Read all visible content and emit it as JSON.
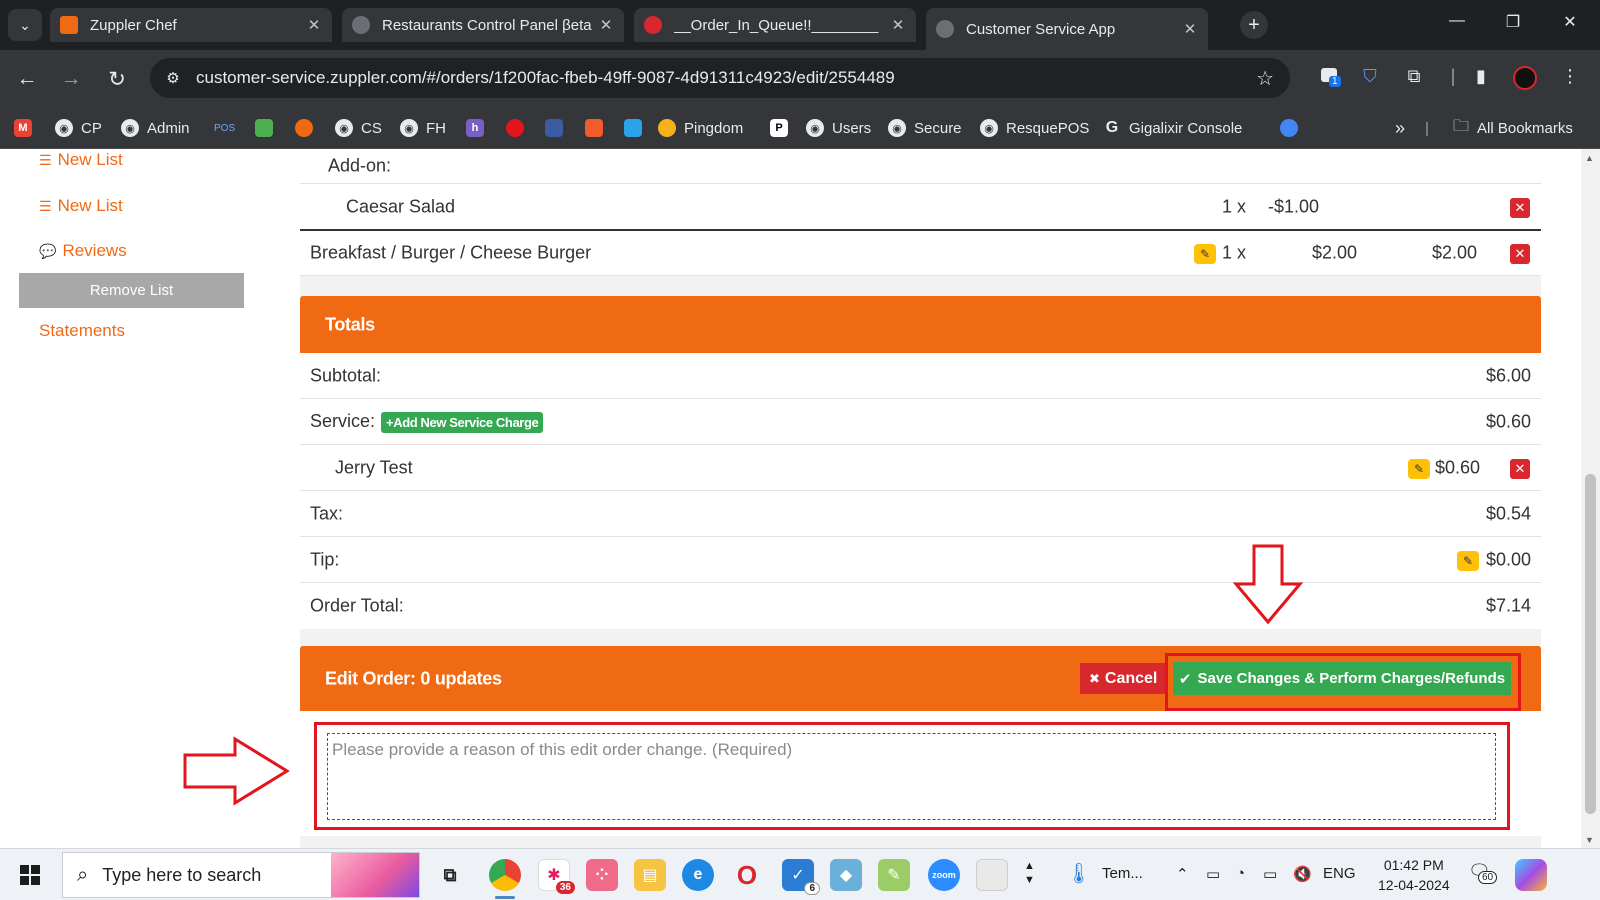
{
  "browser": {
    "tabs": [
      {
        "title": "Zuppler Chef",
        "active": false
      },
      {
        "title": "Restaurants Control Panel βeta",
        "active": false
      },
      {
        "title": "__Order_In_Queue!!________",
        "active": false
      },
      {
        "title": "Customer Service App",
        "active": true
      }
    ],
    "tab_close": "✕",
    "new_tab": "+",
    "url": "customer-service.zuppler.com/#/orders/1f200fac-fbeb-49ff-9087-4d91311c4923/edit/2554489",
    "extension_badge": "1",
    "bookmarks": [
      {
        "label": "CP"
      },
      {
        "label": "Admin"
      },
      {
        "label": "POS"
      },
      {
        "label": "Pingdom"
      },
      {
        "label": "Users"
      },
      {
        "label": "Secure"
      },
      {
        "label": "ResquePOS"
      },
      {
        "label": "Gigalixir Console"
      },
      {
        "label": "All Bookmarks"
      }
    ],
    "bookmark_overflow": "»"
  },
  "sidebar": {
    "links": [
      "New List",
      "New List",
      "Reviews"
    ],
    "remove_button": "Remove List",
    "statements": "Statements"
  },
  "order": {
    "addon_label": "Add-on:",
    "addon_item": {
      "name": "Caesar Salad",
      "qty": "1 x",
      "price": "-$1.00"
    },
    "item": {
      "name": "Breakfast / Burger / Cheese Burger",
      "qty": "1 x",
      "price": "$2.00",
      "total": "$2.00"
    }
  },
  "totals": {
    "title": "Totals",
    "subtotal_label": "Subtotal:",
    "subtotal": "$6.00",
    "service_label": "Service:",
    "add_service_charge": "Add New Service Charge",
    "service": "$0.60",
    "service_item_name": "Jerry Test",
    "service_item_value": "$0.60",
    "tax_label": "Tax:",
    "tax": "$0.54",
    "tip_label": "Tip:",
    "tip": "$0.00",
    "order_total_label": "Order Total:",
    "order_total": "$7.14"
  },
  "edit": {
    "title": "Edit Order: 0 updates",
    "cancel": "Cancel",
    "save": "Save Changes & Perform Charges/Refunds",
    "reason_placeholder": "Please provide a reason of this edit order change. (Required)"
  },
  "taskbar": {
    "search_placeholder": "Type here to search",
    "slack_badge": "36",
    "vscode_badge": "6",
    "weather": "Tem...",
    "language": "ENG",
    "time": "01:42 PM",
    "date": "12-04-2024",
    "notification_count": "60"
  },
  "colors": {
    "accent": "#f06a14",
    "success": "#35a852",
    "danger": "#d9272e",
    "warning": "#ffc107",
    "annotation": "#e3141b"
  }
}
